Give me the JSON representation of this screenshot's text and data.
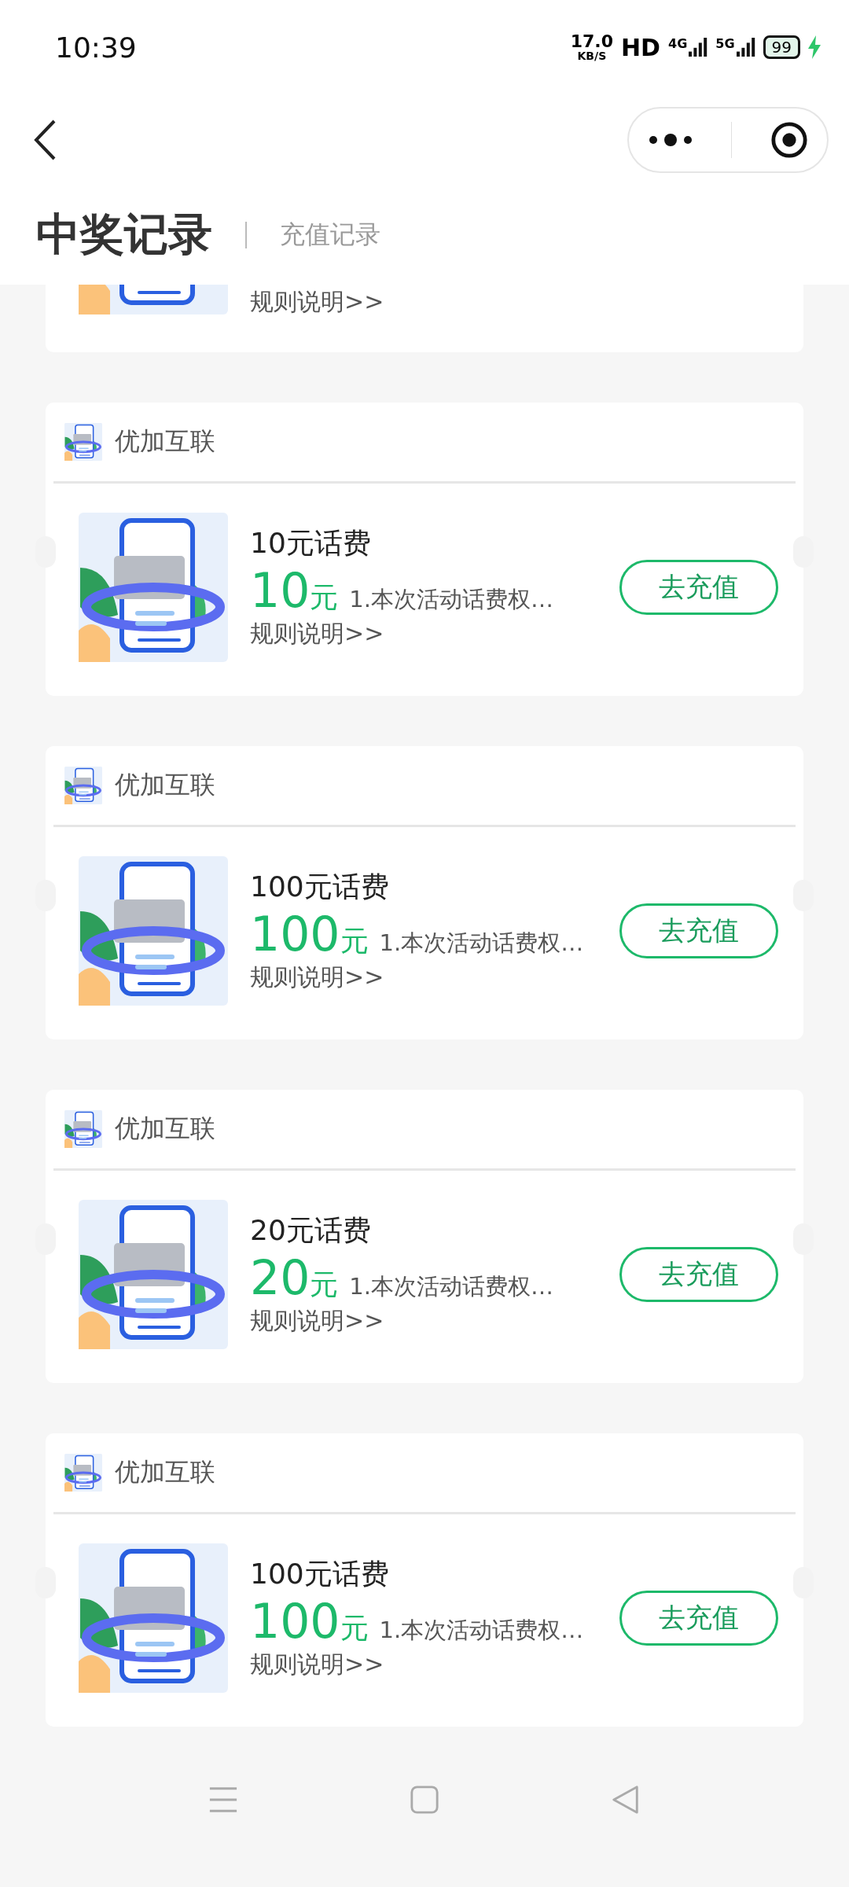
{
  "status_bar": {
    "time": "10:39",
    "net_speed": "17.0",
    "net_speed_unit": "KB/S",
    "hd_label": "HD",
    "network_1": "4G",
    "network_2": "5G",
    "battery": "99",
    "charging": true
  },
  "tabs": [
    {
      "label": "中奖记录",
      "selected": true
    },
    {
      "label": "充值记录",
      "selected": false
    }
  ],
  "partial_card": {
    "rules_link": "规则说明>>"
  },
  "cards": [
    {
      "brand": "优加互联",
      "title": "10元话费",
      "amount": "10",
      "unit": "元",
      "description": "1.本次活动话费权…",
      "rules_link": "规则说明>>",
      "button": "去充值"
    },
    {
      "brand": "优加互联",
      "title": "100元话费",
      "amount": "100",
      "unit": "元",
      "description": "1.本次活动话费权…",
      "rules_link": "规则说明>>",
      "button": "去充值"
    },
    {
      "brand": "优加互联",
      "title": "20元话费",
      "amount": "20",
      "unit": "元",
      "description": "1.本次活动话费权…",
      "rules_link": "规则说明>>",
      "button": "去充值"
    },
    {
      "brand": "优加互联",
      "title": "100元话费",
      "amount": "100",
      "unit": "元",
      "description": "1.本次活动话费权…",
      "rules_link": "规则说明>>",
      "button": "去充值"
    }
  ]
}
